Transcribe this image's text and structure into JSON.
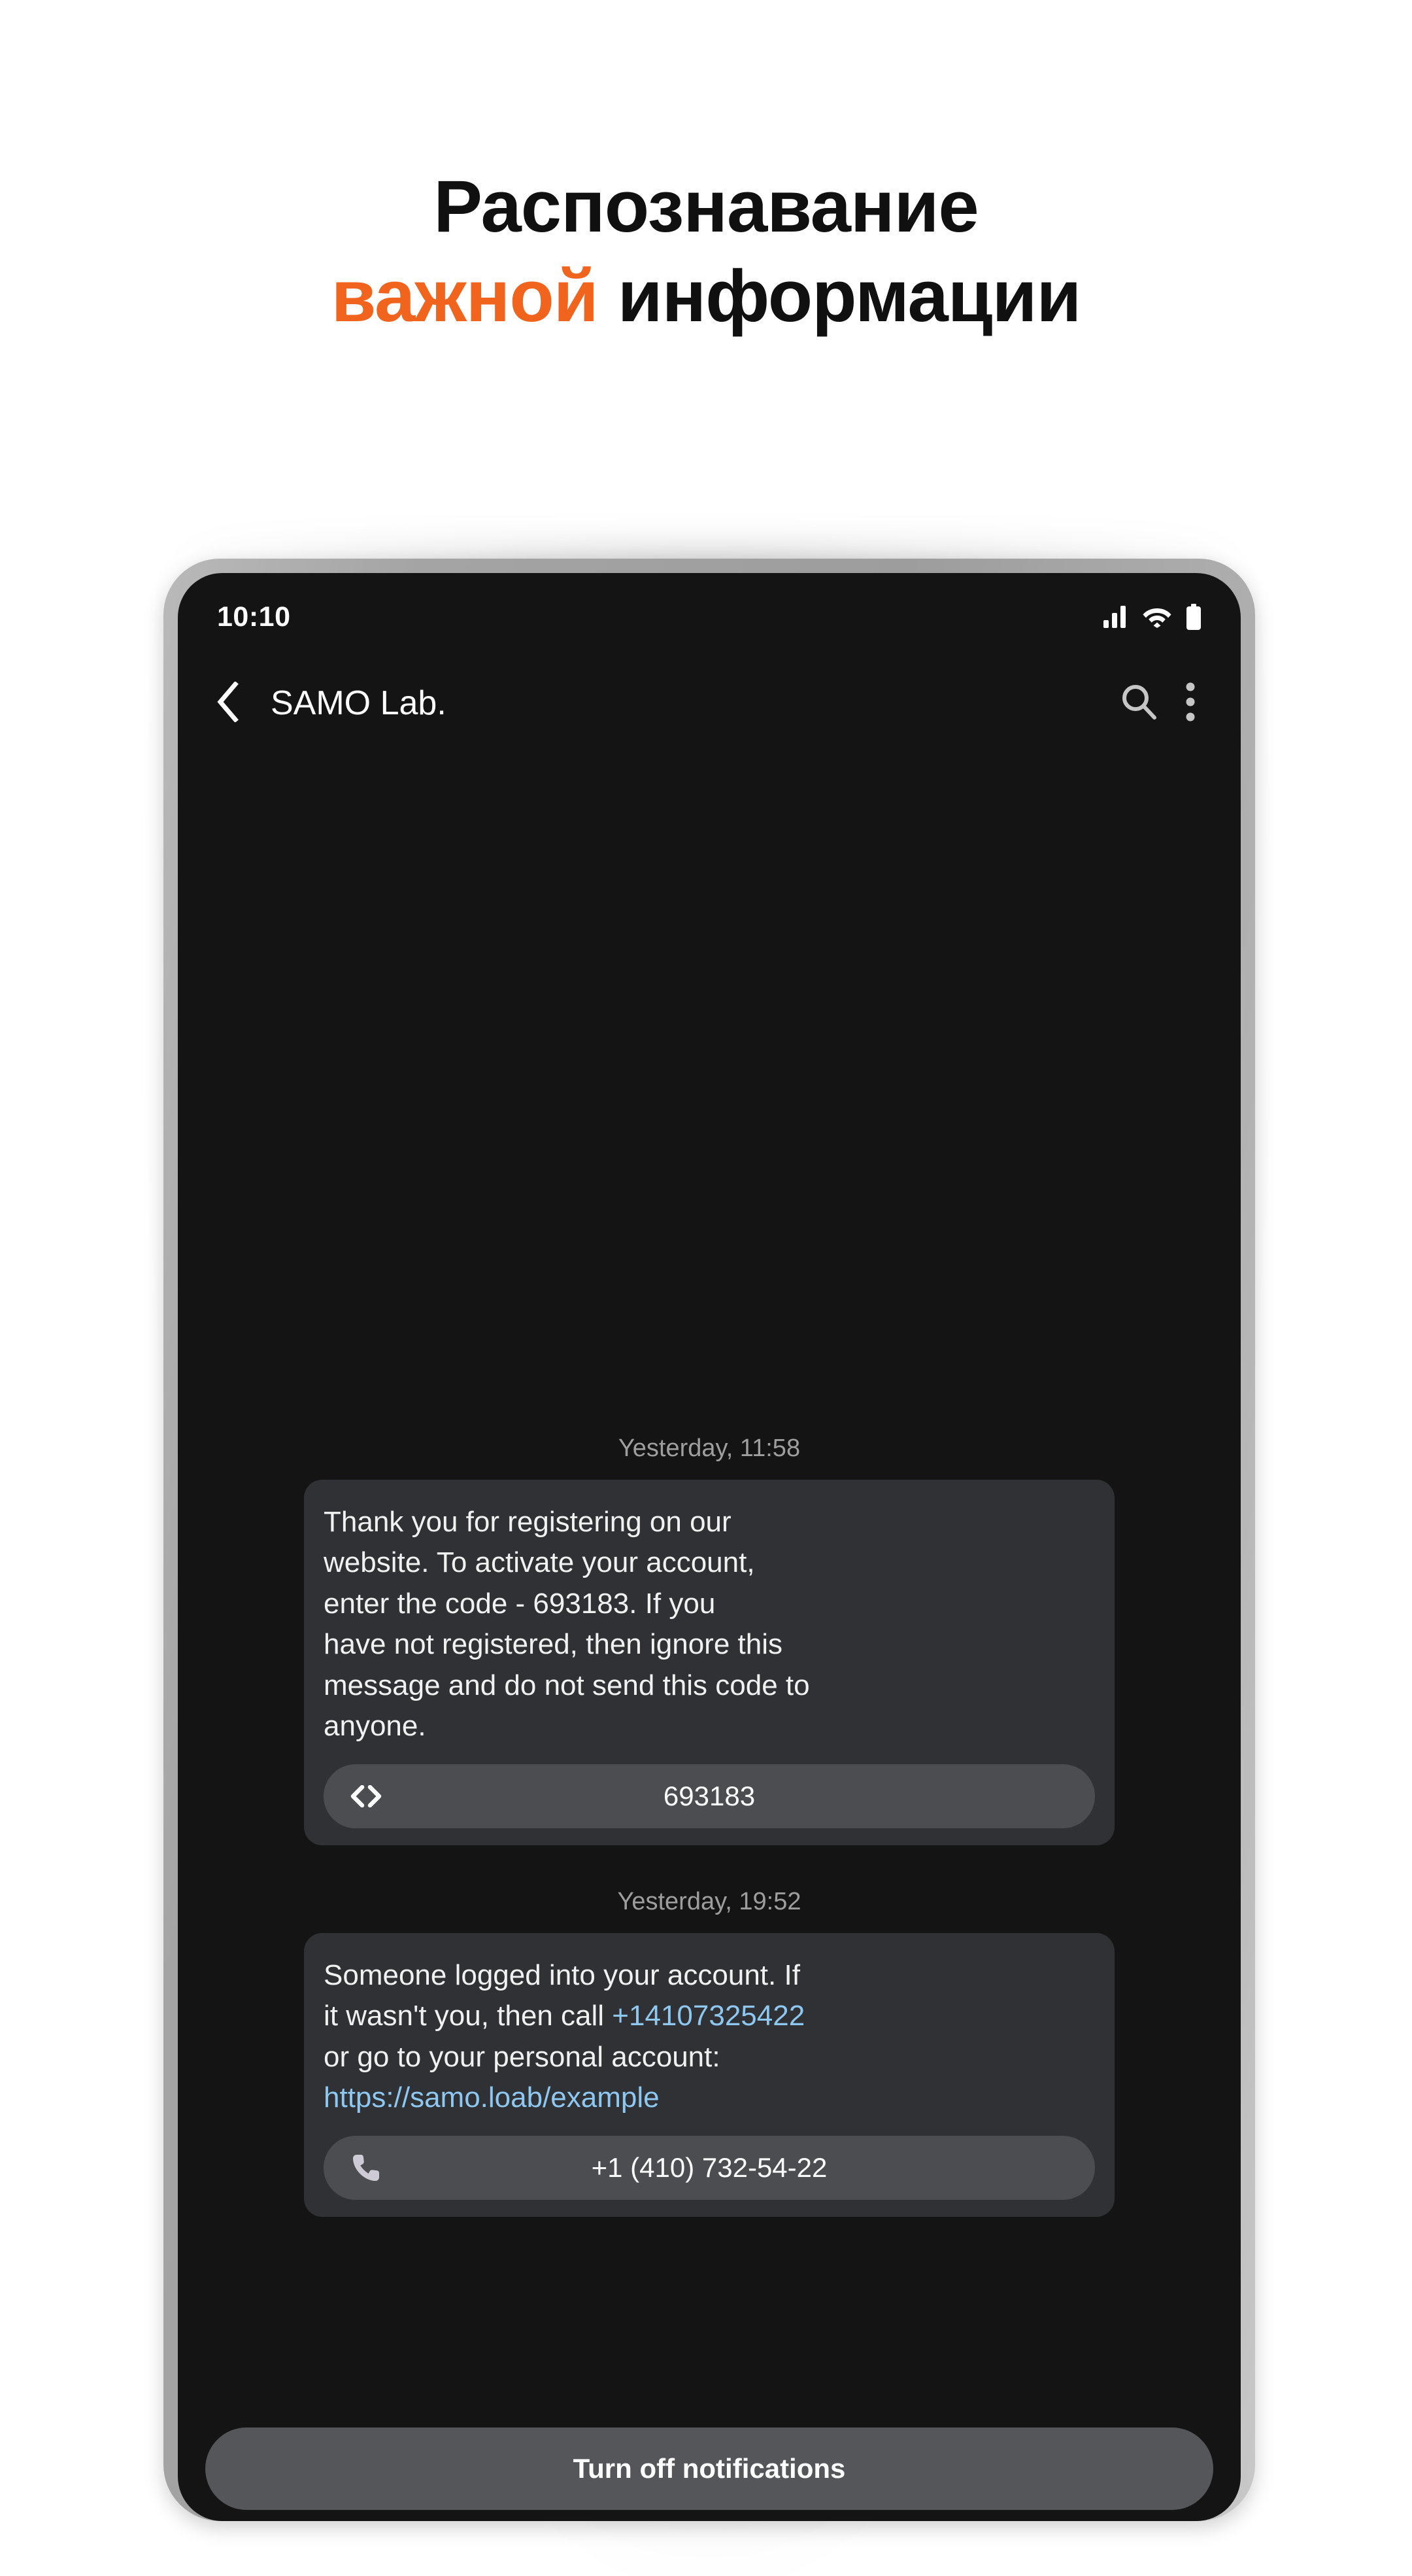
{
  "promo": {
    "headline_line1": "Распознавание",
    "headline_line2_accent": "важной",
    "headline_line2_rest": " информации",
    "accent_color": "#f0641e",
    "text_color": "#101010"
  },
  "status_bar": {
    "time": "10:10",
    "icons": [
      "signal-bars-icon",
      "wifi-icon",
      "battery-full-icon"
    ]
  },
  "app_bar": {
    "back_icon": "chevron-left-icon",
    "title": "SAMO Lab.",
    "search_icon": "search-icon",
    "menu_icon": "overflow-menu-icon"
  },
  "messages": [
    {
      "timestamp": "Yesterday, 11:58",
      "body_line1": "Thank you for registering on our",
      "body_line2": "website. To activate your account,",
      "body_line3": "enter the code - 693183. If you",
      "body_line4": "have not registered, then ignore this",
      "body_line5": "message and do not send this code to",
      "body_line6": "anyone.",
      "chip": {
        "icon": "code-brackets-icon",
        "label": "693183"
      }
    },
    {
      "timestamp": "Yesterday, 19:52",
      "body_line1": "Someone logged into your account. If",
      "body_line2_plain": "it wasn't you, then call ",
      "body_line2_link": "+14107325422",
      "body_line3": "or go to your personal account:",
      "body_line4_link": "https://samo.loab/example",
      "chip": {
        "icon": "phone-handset-icon",
        "label": "+1 (410) 732-54-22"
      }
    }
  ],
  "bottom_action": {
    "label": "Turn off notifications"
  },
  "theme": {
    "screen_bg": "#141414",
    "bubble_bg": "#303134",
    "chip_bg": "#4c4d50",
    "button_bg": "#55565a",
    "link_color": "#8ec7f0",
    "timestamp_color": "#9e9e9e",
    "bezel_color": "#a4a4a4"
  }
}
